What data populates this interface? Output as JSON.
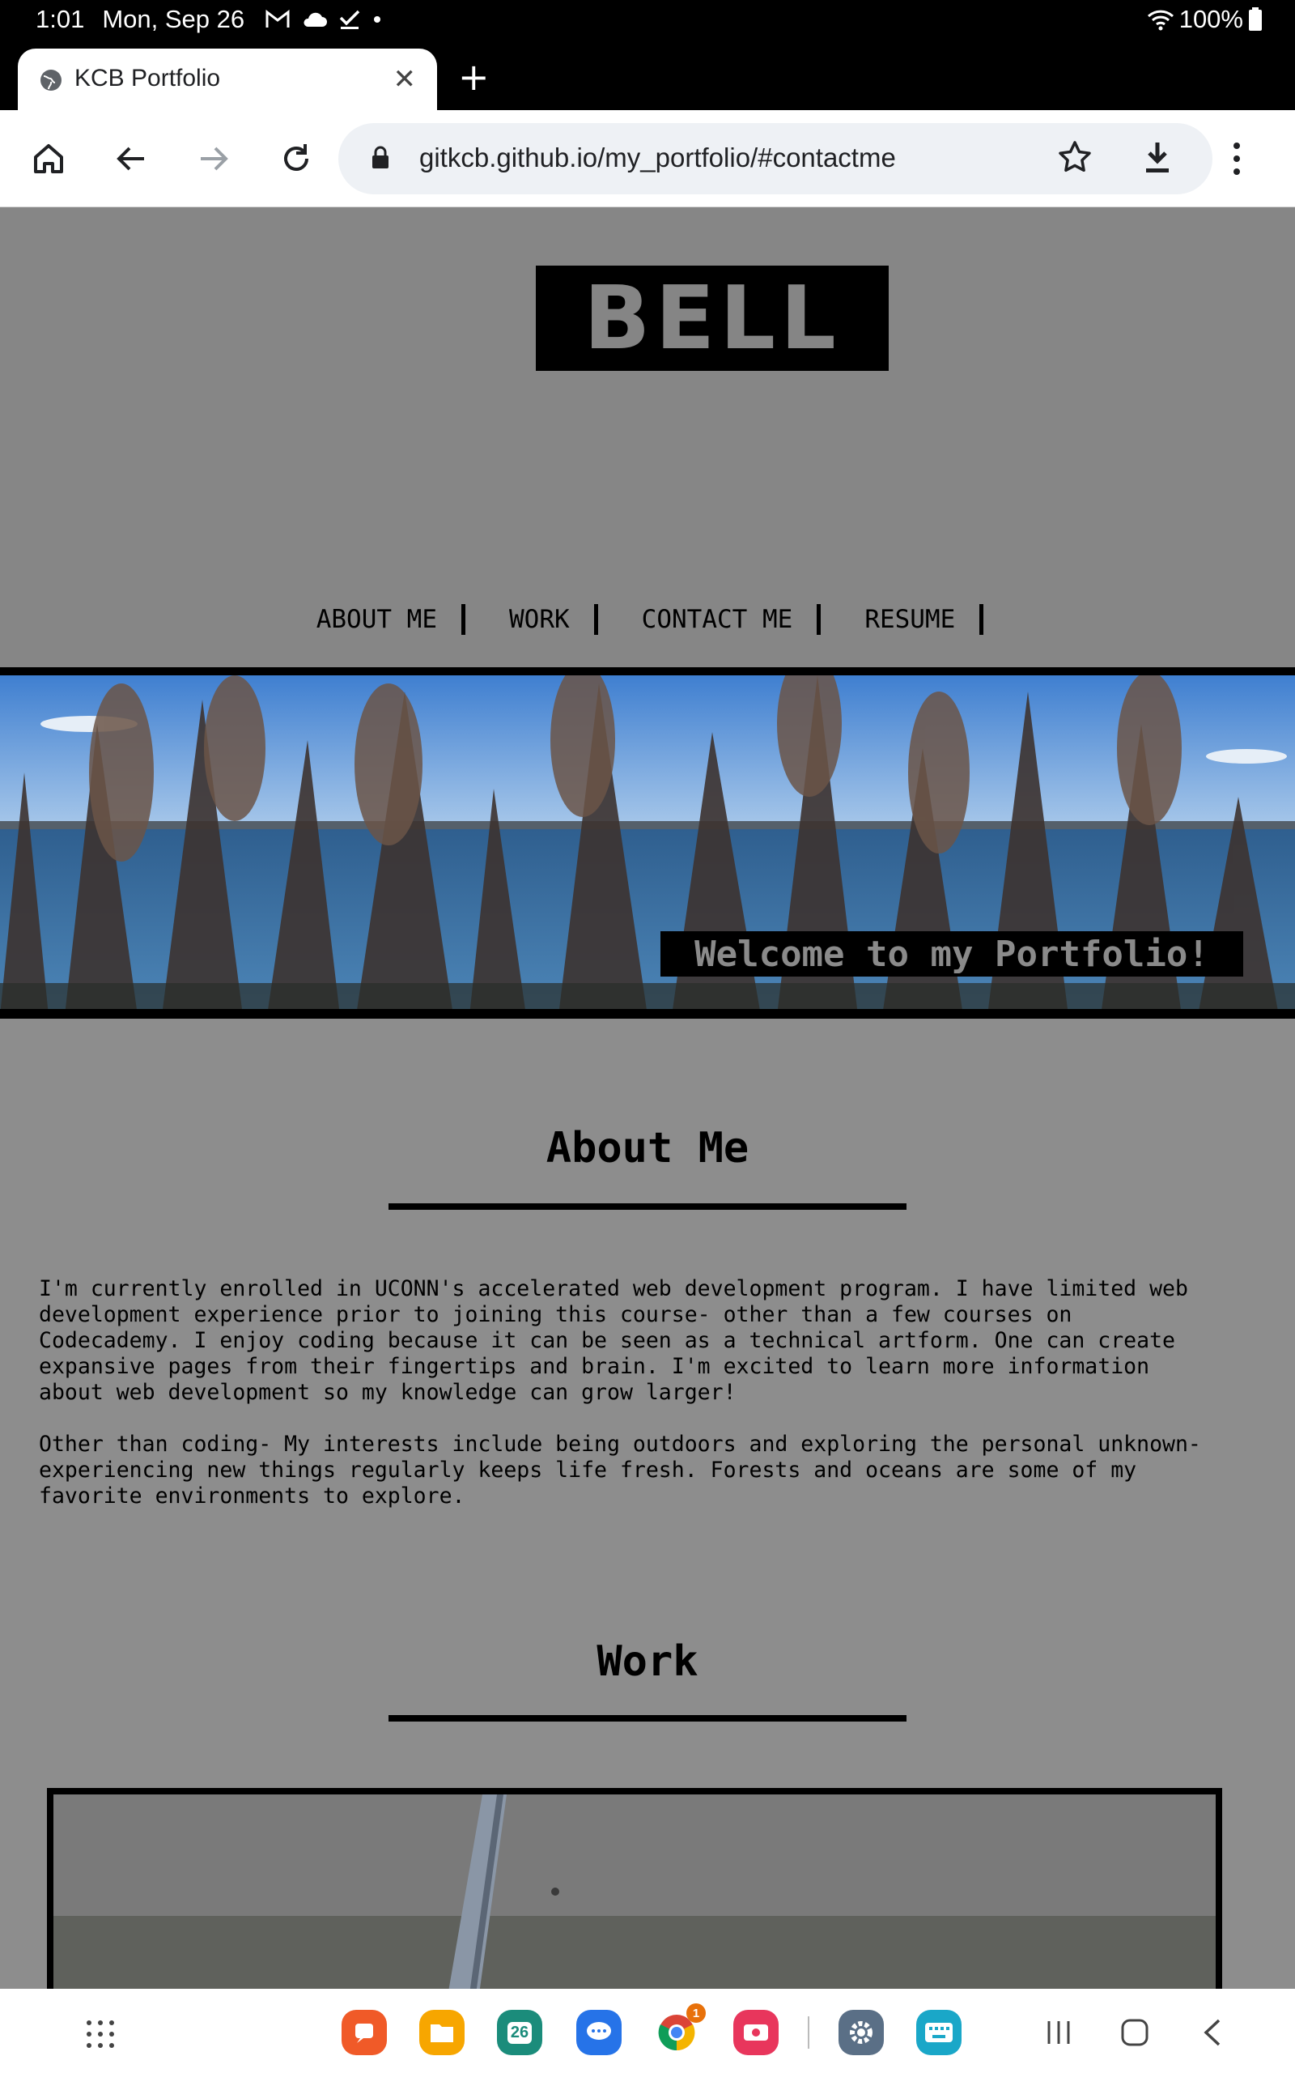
{
  "status_bar": {
    "time": "1:01",
    "date": "Mon, Sep 26",
    "battery": "100%"
  },
  "browser": {
    "tab_title": "KCB Portfolio",
    "url": "gitkcb.github.io/my_portfolio/#contactme",
    "icons": [
      "home-icon",
      "back-icon",
      "forward-icon",
      "reload-icon",
      "lock-icon",
      "star-icon",
      "download-icon",
      "more-icon"
    ]
  },
  "site": {
    "logo": "BELL",
    "nav": [
      "ABOUT ME",
      "WORK",
      "CONTACT ME",
      "RESUME"
    ],
    "hero_caption": "Welcome to my Portfolio!",
    "about": {
      "heading": "About Me",
      "paragraph1": "I'm currently enrolled in UCONN's accelerated web development program. I have limited web\ndevelopment experience prior to joining this course- other than a few courses on\nCodecademy. I enjoy coding because it can be seen as a technical artform. One can create\nexpansive pages from their fingertips and brain. I'm excited to learn more information\nabout web development so my knowledge can grow larger!",
      "paragraph2": "Other than coding- My interests include being outdoors and exploring the personal unknown-\nexperiencing new things regularly keeps life fresh. Forests and oceans are some of my\nfavorite environments to explore."
    },
    "work": {
      "heading": "Work"
    },
    "colors": {
      "page_bg": "#868686",
      "logo_bg": "#000000",
      "logo_text": "#858585"
    }
  },
  "dock": {
    "calendar_date": "26",
    "chrome_badge": "1",
    "apps": [
      "app-drawer-icon",
      "notes-app-icon",
      "my-files-icon",
      "calendar-icon",
      "messages-icon",
      "chrome-icon",
      "screen-recorder-icon",
      "settings-icon",
      "keyboard-icon"
    ],
    "nav": [
      "recents-icon",
      "home-nav-icon",
      "back-nav-icon"
    ]
  }
}
